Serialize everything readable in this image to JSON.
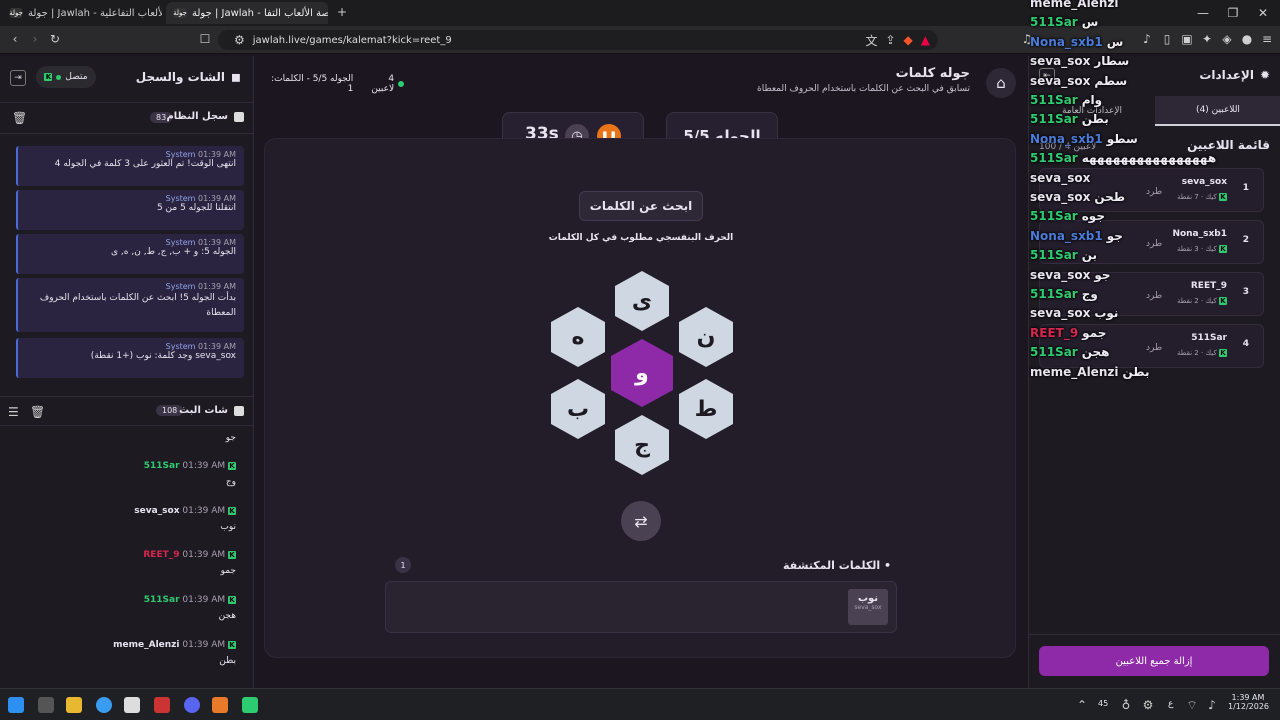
{
  "browser": {
    "tabs": [
      {
        "label": "جولة | Jawlah - منصة الألعاب التفاعلية",
        "fav": "جولة"
      },
      {
        "label": "جولة | Jawlah - منصة الألعاب التفا",
        "fav": "جولة"
      }
    ],
    "new_tab": "+",
    "url": "jawlah.live/games/kalemat?kick=reet_9"
  },
  "chat_pane": {
    "title": "الشات والسجل",
    "status": "متصل",
    "system_log": {
      "title": "سجل النظام",
      "count": "83",
      "messages": [
        {
          "sender": "System",
          "time": "01:39 AM",
          "text": "انتهى الوقت! تم العثور على 3 كلمة في الجوله 4"
        },
        {
          "sender": "System",
          "time": "01:39 AM",
          "text": "انتقلنا للجوله 5 من 5"
        },
        {
          "sender": "System",
          "time": "01:39 AM",
          "text": "الجوله 5: و + ب, ج, ط, ن, ه, ى"
        },
        {
          "sender": "System",
          "time": "01:39 AM",
          "text": "بدأت الجوله 5! ابحث عن الكلمات باستخدام الحروف المعطاة"
        },
        {
          "sender": "System",
          "time": "01:39 AM",
          "text": "seva_sox وجد كلمة: نوب (+1 نقطة)"
        }
      ]
    },
    "stream_chat": {
      "title": "شات البث",
      "count": "108",
      "first_text": "جو",
      "messages": [
        {
          "name": "511Sar",
          "time": "01:39 AM",
          "text": "وج",
          "color": "#2ecc71"
        },
        {
          "name": "seva_sox",
          "time": "01:39 AM",
          "text": "نوب",
          "color": "#e8e3ee"
        },
        {
          "name": "REET_9",
          "time": "01:39 AM",
          "text": "جمو",
          "color": "#d6284f"
        },
        {
          "name": "511Sar",
          "time": "01:39 AM",
          "text": "هجن",
          "color": "#2ecc71"
        },
        {
          "name": "meme_Alenzi",
          "time": "01:39 AM",
          "text": "بطن",
          "color": "#e8e3ee"
        }
      ]
    }
  },
  "game": {
    "title": "جوله كلمات",
    "subtitle": "تسابق في البحث عن الكلمات باستخدام الحروف المعطاة",
    "players_online": "4 لاعبين",
    "round_info": "الجوله 5/5 - الكلمات: 1",
    "round_box": "الجوله 5/5",
    "timer": "33s",
    "prompt_title": "ابحث عن الكلمات",
    "prompt_sub": "الحرف البنفسجي مطلوب في كل الكلمات",
    "letters": {
      "top": "ى",
      "top_right": "ن",
      "bottom_right": "ط",
      "bottom": "ج",
      "bottom_left": "ب",
      "top_left": "ه",
      "center": "و"
    },
    "found_title": "الكلمات المكتشفة",
    "found_count": "1",
    "found_words": [
      {
        "word": "نوب",
        "by": "seva_sox"
      }
    ]
  },
  "right_pane": {
    "settings": "الإعدادات",
    "players_tab": "اللاعبين (4)",
    "overlay_tab": "الإعدادات العامة",
    "list_title": "قائمة اللاعبين",
    "capacity": "100 / 4 لاعبين",
    "players": [
      {
        "rank": "1",
        "name": "seva_sox",
        "pts": "7 نقطة",
        "source": "كيك"
      },
      {
        "rank": "2",
        "name": "Nona_sxb1",
        "pts": "3 نقطة",
        "source": "كيك"
      },
      {
        "rank": "3",
        "name": "REET_9",
        "pts": "2 نقطة",
        "source": "كيك"
      },
      {
        "rank": "4",
        "name": "511Sar",
        "pts": "2 نقطة",
        "source": "كيك"
      }
    ],
    "kick_label": "طرد",
    "remove_all": "إزالة جميع اللاعبين"
  },
  "overlay_chat": [
    {
      "name": "meme_Alenzi",
      "text": "",
      "color": "#e8e3ee"
    },
    {
      "name": "511Sar",
      "text": "س",
      "color": "#2ecc71"
    },
    {
      "name": "Nona_sxb1",
      "text": "س",
      "color": "#4b7bd8"
    },
    {
      "name": "seva_sox",
      "text": "سطار",
      "color": "#e8e3ee"
    },
    {
      "name": "seva_sox",
      "text": "سطم",
      "color": "#e8e3ee"
    },
    {
      "name": "511Sar",
      "text": "وام",
      "color": "#2ecc71"
    },
    {
      "name": "511Sar",
      "text": "بطن",
      "color": "#2ecc71"
    },
    {
      "name": "Nona_sxb1",
      "text": "سطو",
      "color": "#4b7bd8"
    },
    {
      "name": "511Sar",
      "text": "ههههههههههههههههه",
      "color": "#2ecc71"
    },
    {
      "name": "seva_sox",
      "text": "",
      "color": "#e8e3ee"
    },
    {
      "name": "seva_sox",
      "text": "طحن",
      "color": "#e8e3ee"
    },
    {
      "name": "511Sar",
      "text": "جوه",
      "color": "#2ecc71"
    },
    {
      "name": "Nona_sxb1",
      "text": "جو",
      "color": "#4b7bd8"
    },
    {
      "name": "511Sar",
      "text": "بن",
      "color": "#2ecc71"
    },
    {
      "name": "seva_sox",
      "text": "جو",
      "color": "#e8e3ee"
    },
    {
      "name": "511Sar",
      "text": "وج",
      "color": "#2ecc71"
    },
    {
      "name": "seva_sox",
      "text": "نوب",
      "color": "#e8e3ee"
    },
    {
      "name": "REET_9",
      "text": "جمو",
      "color": "#d6284f"
    },
    {
      "name": "511Sar",
      "text": "هجن",
      "color": "#2ecc71"
    },
    {
      "name": "meme_Alenzi",
      "text": "بطن",
      "color": "#e8e3ee"
    }
  ],
  "taskbar": {
    "time": "1:39 AM",
    "date": "1/12/2026",
    "badge": "45",
    "lang": "ع"
  },
  "colors": {
    "accent": "#8e2aa8",
    "kick_green": "#2ecc71",
    "system_blue": "#4b6cd6",
    "timer_orange": "#e8751a"
  }
}
